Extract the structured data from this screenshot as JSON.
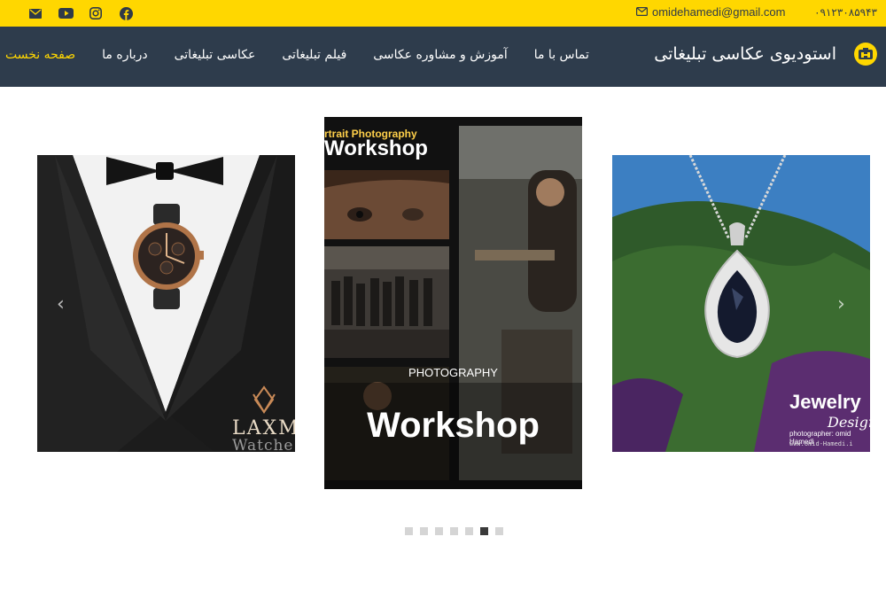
{
  "topbar": {
    "email": "omidehamedi@gmail.com",
    "phone": "۰۹۱۲۳۰۸۵۹۴۳",
    "social_icons": [
      "facebook-icon",
      "instagram-icon",
      "youtube-icon",
      "mail-icon"
    ],
    "background": "#ffd700"
  },
  "nav": {
    "brand": "استودیوی عکاسی تبلیغاتی",
    "items": [
      {
        "label": "صفحه نخست",
        "active": true
      },
      {
        "label": "درباره ما",
        "active": false
      },
      {
        "label": "عکاسی تبلیغاتی",
        "active": false
      },
      {
        "label": "فیلم تبلیغاتی",
        "active": false
      },
      {
        "label": "آموزش و مشاوره عکاسی",
        "active": false
      },
      {
        "label": "تماس با ما",
        "active": false
      }
    ],
    "background": "#2e3c4c",
    "active_color": "#ffd700"
  },
  "slider": {
    "slides": [
      {
        "brand_text": "LAXM",
        "brand_sub": "Watche"
      },
      {
        "poster_title": "rtrait Photography",
        "poster_heading": "Workshop",
        "caption_small": "PHOTOGRAPHY",
        "caption_big": "Workshop"
      },
      {
        "title": "Jewelry",
        "subtitle": "Design",
        "credit": "photographer: omid Hamedi",
        "url": "www.omid-Hamedi.i"
      }
    ],
    "dot_count": 7,
    "active_dot": 6
  }
}
